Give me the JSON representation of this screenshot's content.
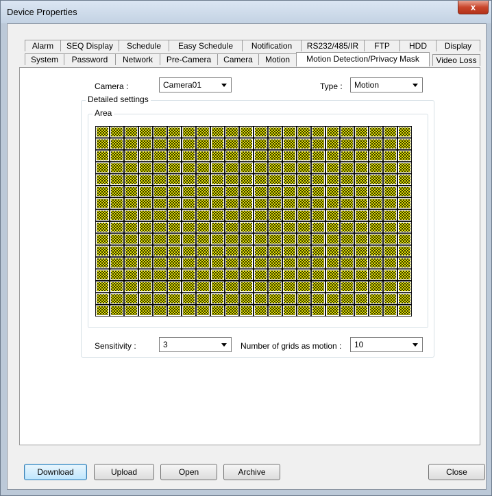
{
  "window": {
    "title": "Device Properties",
    "close_glyph": "x"
  },
  "tabs_row1": [
    "Alarm",
    "SEQ Display",
    "Schedule",
    "Easy Schedule",
    "Notification",
    "RS232/485/IR",
    "FTP",
    "HDD",
    "Display"
  ],
  "tabs_row2": [
    "System",
    "Password",
    "Network",
    "Pre-Camera",
    "Camera",
    "Motion",
    "Motion Detection/Privacy Mask",
    "Video Loss"
  ],
  "active_tab": "Motion Detection/Privacy Mask",
  "camera": {
    "label": "Camera :",
    "value": "Camera01"
  },
  "type": {
    "label": "Type :",
    "value": "Motion"
  },
  "detailed": {
    "title": "Detailed settings",
    "area_title": "Area"
  },
  "grid": {
    "columns": 22,
    "rows": 16,
    "line_color": "#ffff00",
    "cell_color": "#000000"
  },
  "sensitivity": {
    "label": "Sensitivity :",
    "value": "3"
  },
  "grids_motion": {
    "label": "Number of grids as motion :",
    "value": "10"
  },
  "buttons": {
    "download": "Download",
    "upload": "Upload",
    "open": "Open",
    "archive": "Archive",
    "close": "Close"
  }
}
